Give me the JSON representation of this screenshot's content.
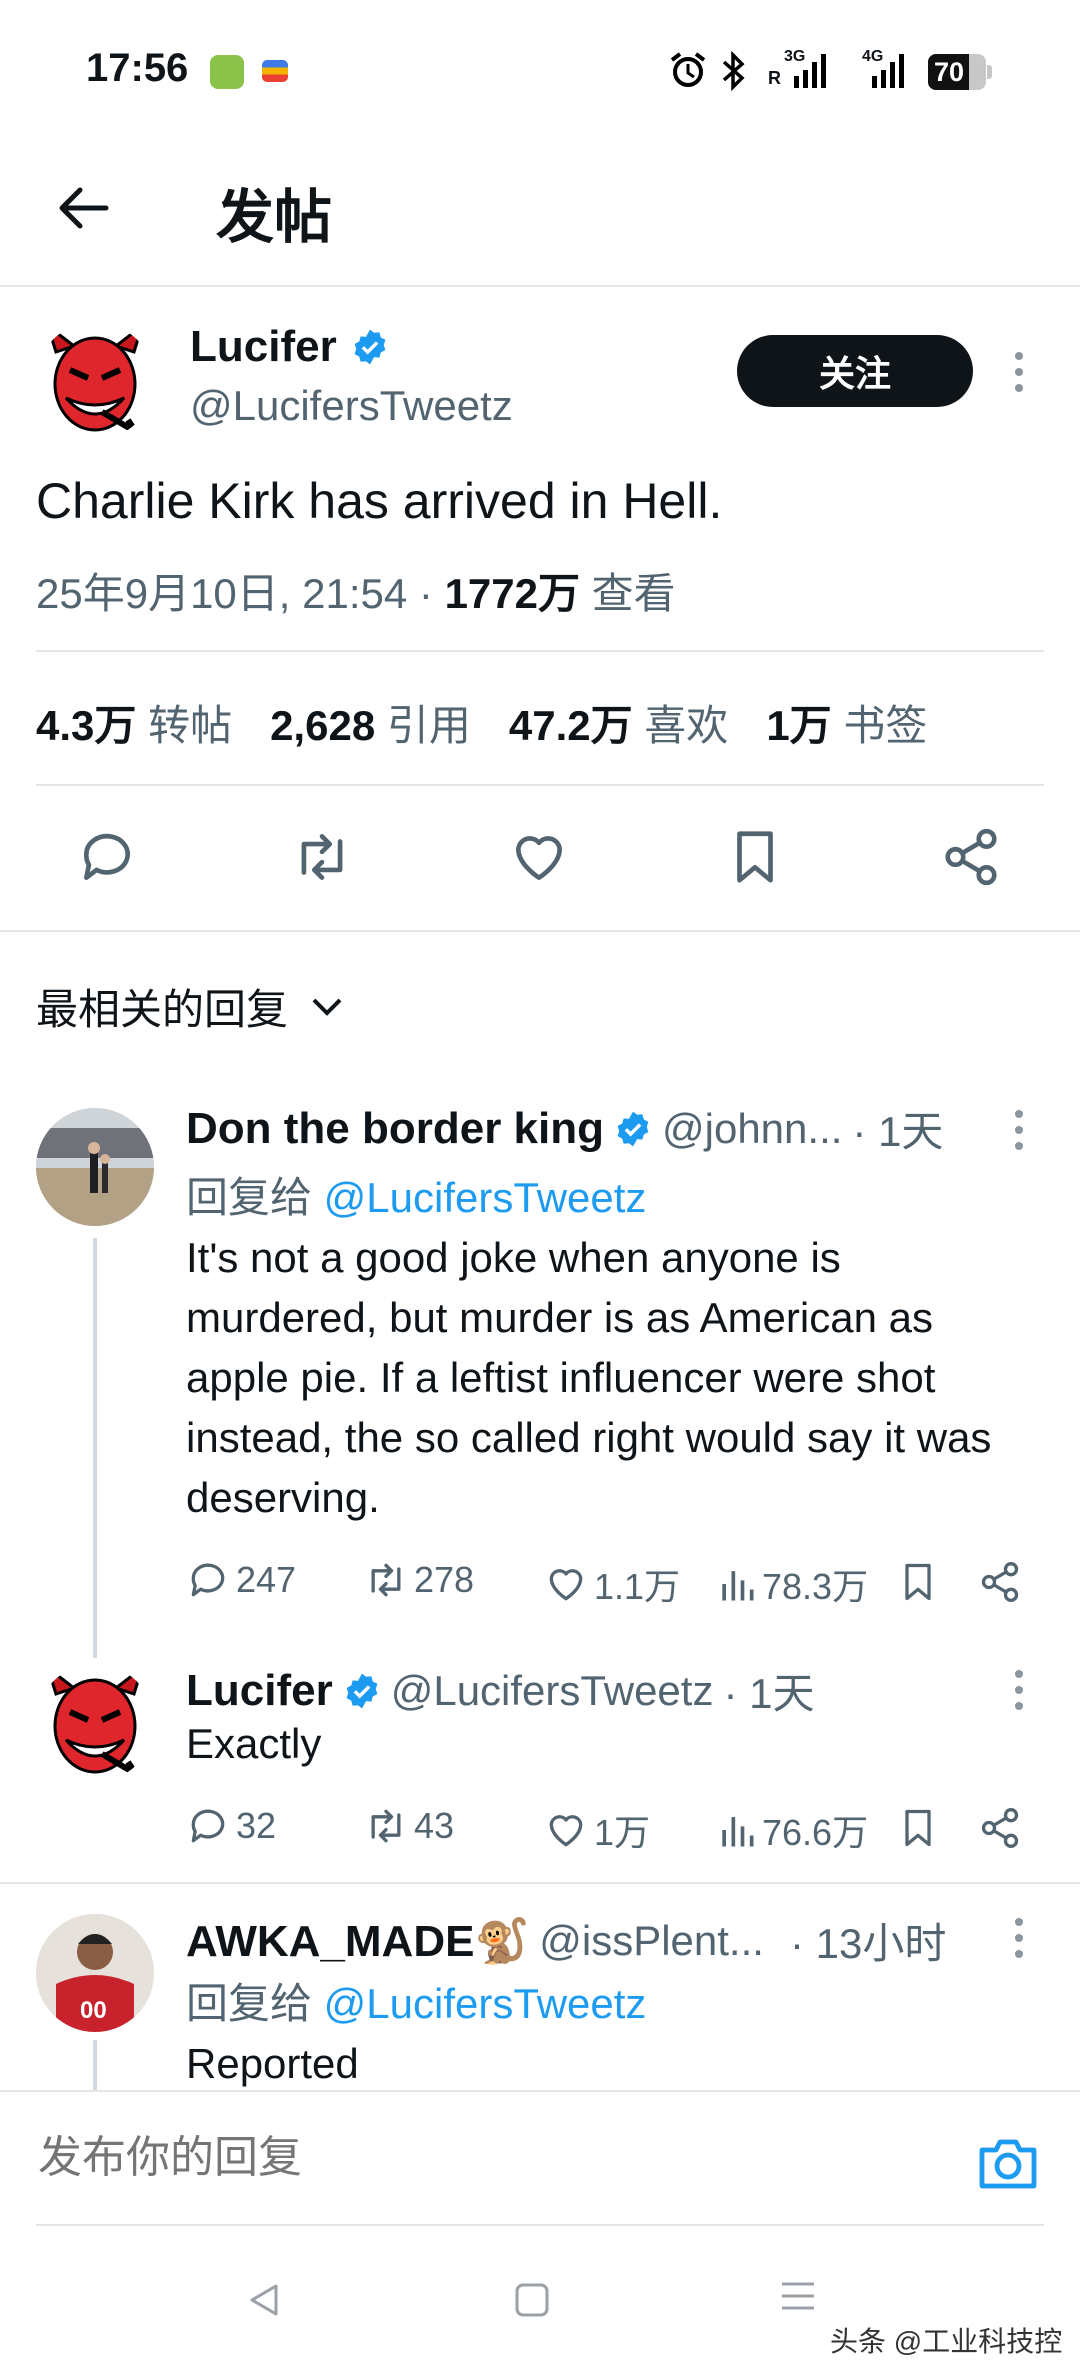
{
  "status_bar": {
    "time": "17:56",
    "signal1": "3G",
    "signal2": "4G",
    "battery": "70"
  },
  "header": {
    "title": "发帖"
  },
  "post": {
    "name": "Lucifer",
    "handle": "@LucifersTweetz",
    "follow_label": "关注",
    "text": "Charlie Kirk has arrived in Hell.",
    "date": "25年9月10日, 21:54 · ",
    "views": "1772万",
    "views_label": " 查看",
    "stats": [
      {
        "value": "4.3万",
        "label": "转帖"
      },
      {
        "value": "2,628",
        "label": "引用"
      },
      {
        "value": "47.2万",
        "label": "喜欢"
      },
      {
        "value": "1万",
        "label": "书签"
      }
    ]
  },
  "sort_label": "最相关的回复",
  "replies": [
    {
      "name": "Don the border king",
      "handle": "@johnn...",
      "time": "· 1天",
      "reply_to_prefix": "回复给 ",
      "reply_to": "@LucifersTweetz",
      "text": "It's not a good joke when anyone is murdered, but murder is as American as apple pie.  If a leftist influencer were shot instead, the so called right would say it was deserving.",
      "comments": "247",
      "retweets": "278",
      "likes": "1.1万",
      "views": "78.3万"
    },
    {
      "name": "Lucifer",
      "handle": "@LucifersTweetz",
      "time": "· 1天",
      "text": "Exactly",
      "comments": "32",
      "retweets": "43",
      "likes": "1万",
      "views": "76.6万"
    },
    {
      "name": "AWKA_MADE🐒",
      "handle": "@issPlent...",
      "time": "· 13小时",
      "reply_to_prefix": "回复给 ",
      "reply_to": "@LucifersTweetz",
      "text": "Reported"
    }
  ],
  "composer": {
    "placeholder": "发布你的回复"
  },
  "watermark": "头条 @工业科技控",
  "colors": {
    "accent": "#1d9bf0",
    "text": "#0f1419",
    "muted": "#536471",
    "divider": "#e4e7ea"
  }
}
